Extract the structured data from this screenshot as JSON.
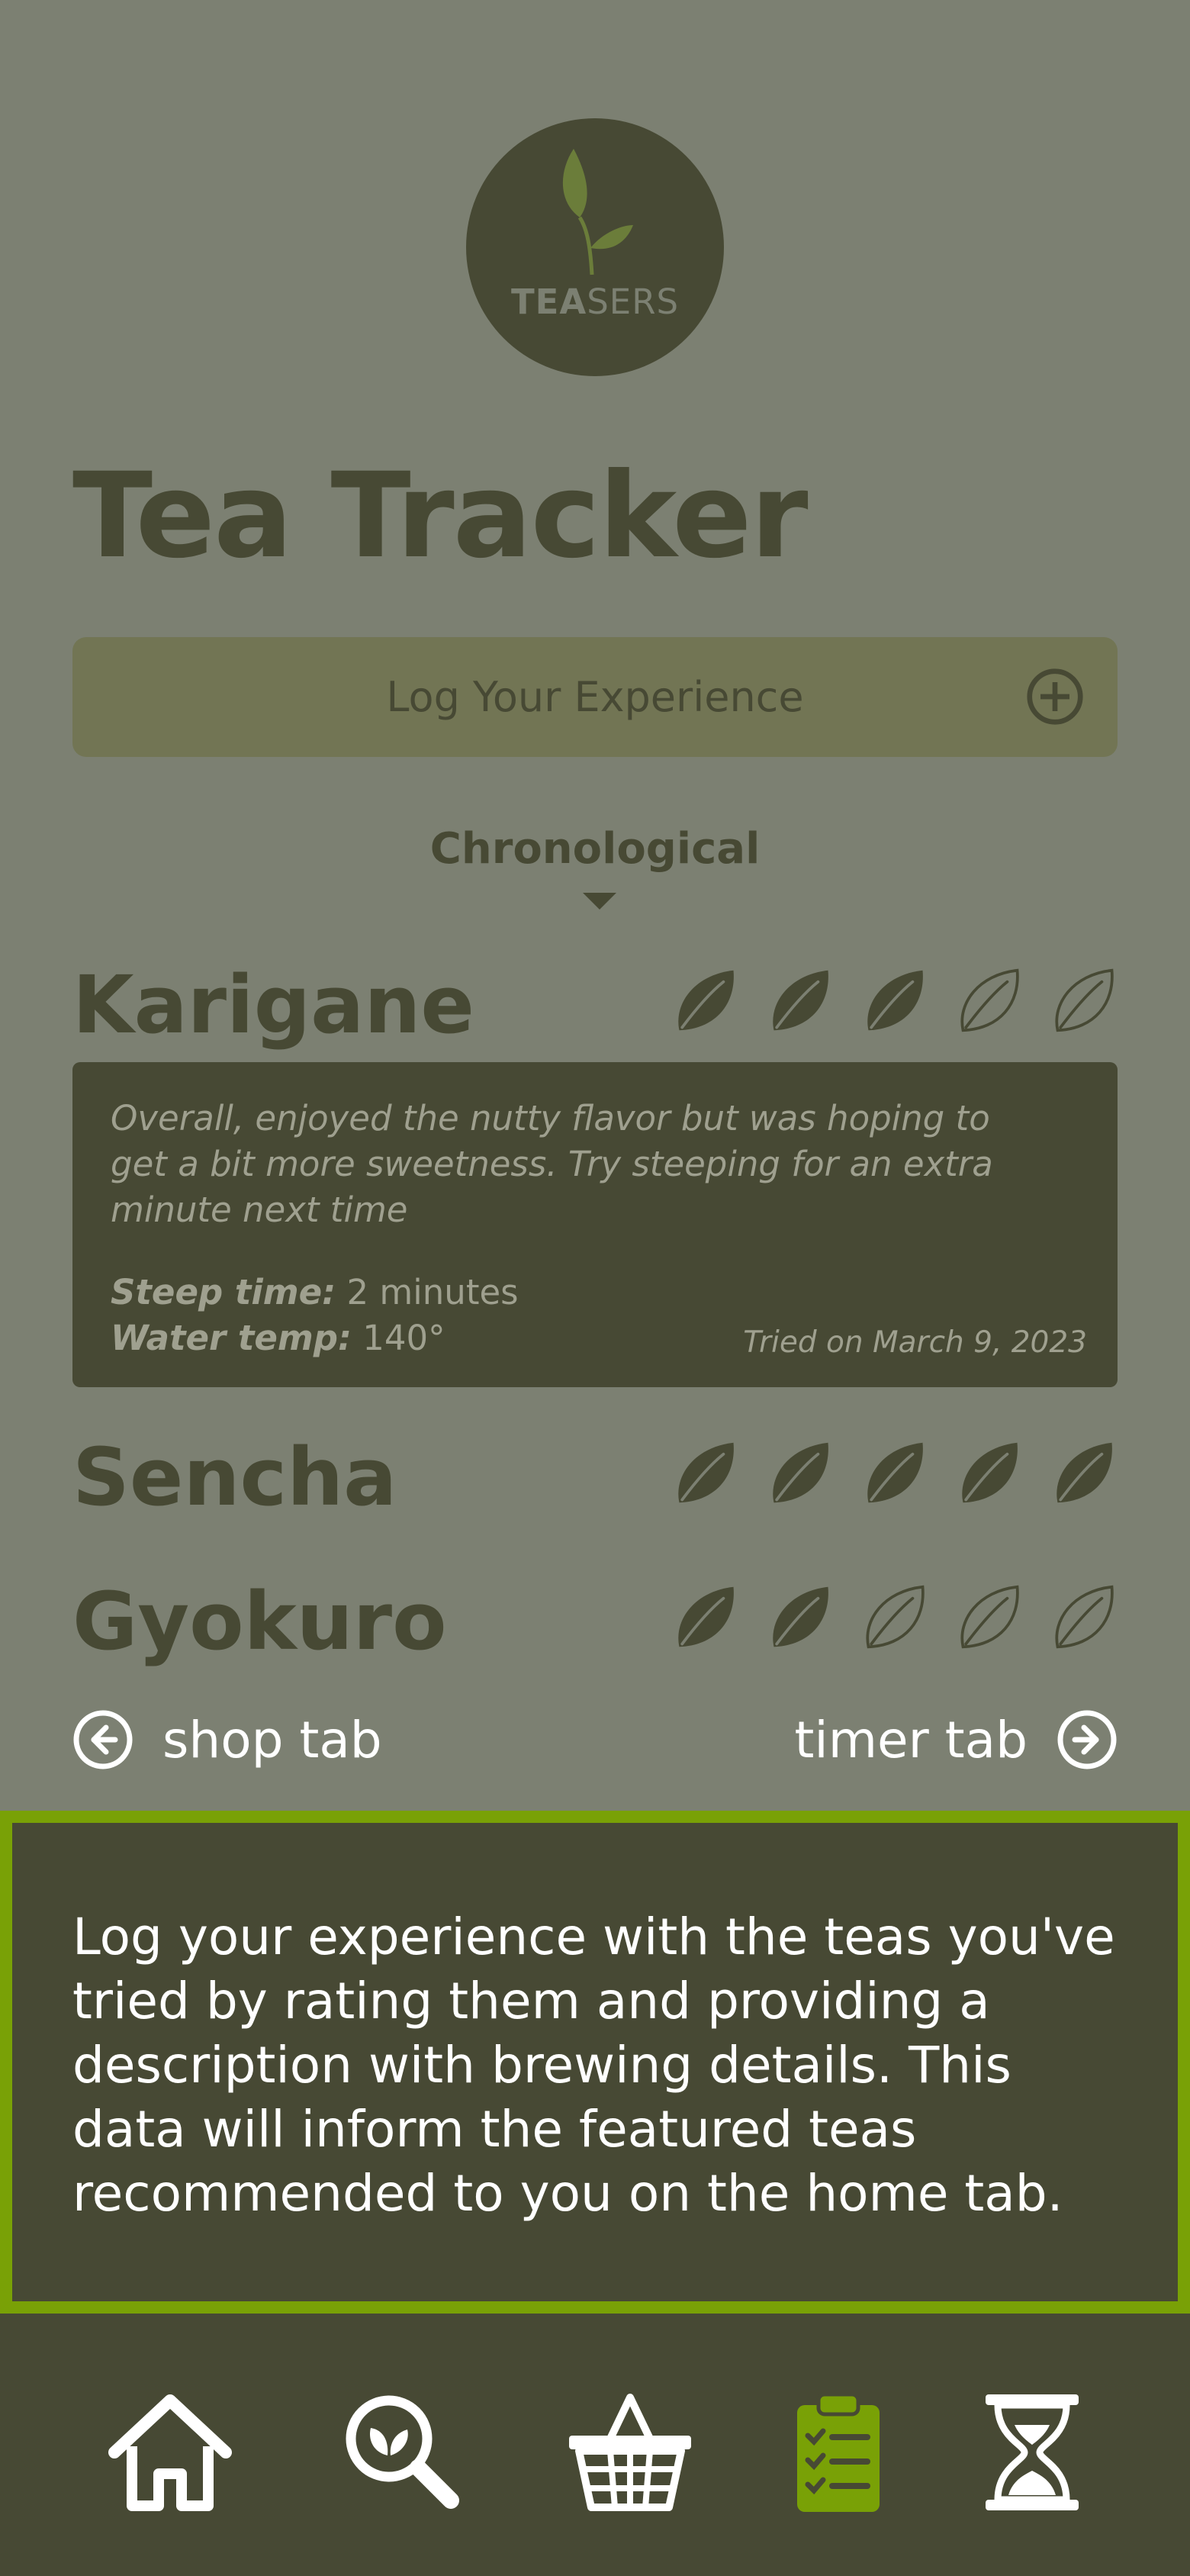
{
  "brand": {
    "logo_bold": "TEA",
    "logo_light": "SERS"
  },
  "page_title": "Tea Tracker",
  "log_button": {
    "label": "Log Your Experience",
    "icon": "plus-circle-icon"
  },
  "sort": {
    "label": "Chronological",
    "icon": "caret-down-icon"
  },
  "teas": [
    {
      "name": "Karigane",
      "rating": 3,
      "max_rating": 5,
      "expanded": true,
      "description": "Overall, enjoyed the nutty flavor but was hoping to get a bit more sweetness. Try steeping for an extra minute next time",
      "steep_label": "Steep time:",
      "steep_value": "2 minutes",
      "temp_label": "Water temp:",
      "temp_value": "140°",
      "tried": "Tried on March 9, 2023"
    },
    {
      "name": "Sencha",
      "rating": 5,
      "max_rating": 5
    },
    {
      "name": "Gyokuro",
      "rating": 2,
      "max_rating": 5
    }
  ],
  "nav": {
    "prev_label": "shop tab",
    "next_label": "timer tab"
  },
  "info": "Log your experience with the teas you've tried by rating them and providing a description with brewing details. This data will inform the featured teas recommended to you on the home tab.",
  "tabs": [
    {
      "name": "home",
      "icon": "home-icon",
      "active": false
    },
    {
      "name": "search",
      "icon": "search-leaf-icon",
      "active": false
    },
    {
      "name": "shop",
      "icon": "basket-icon",
      "active": false
    },
    {
      "name": "tracker",
      "icon": "clipboard-checklist-icon",
      "active": true
    },
    {
      "name": "timer",
      "icon": "hourglass-icon",
      "active": false
    }
  ],
  "colors": {
    "background": "#7c8072",
    "dark": "#474934",
    "accent": "#79a106",
    "button": "#727554",
    "muted_text": "#9fa08f",
    "white": "#ffffff"
  }
}
